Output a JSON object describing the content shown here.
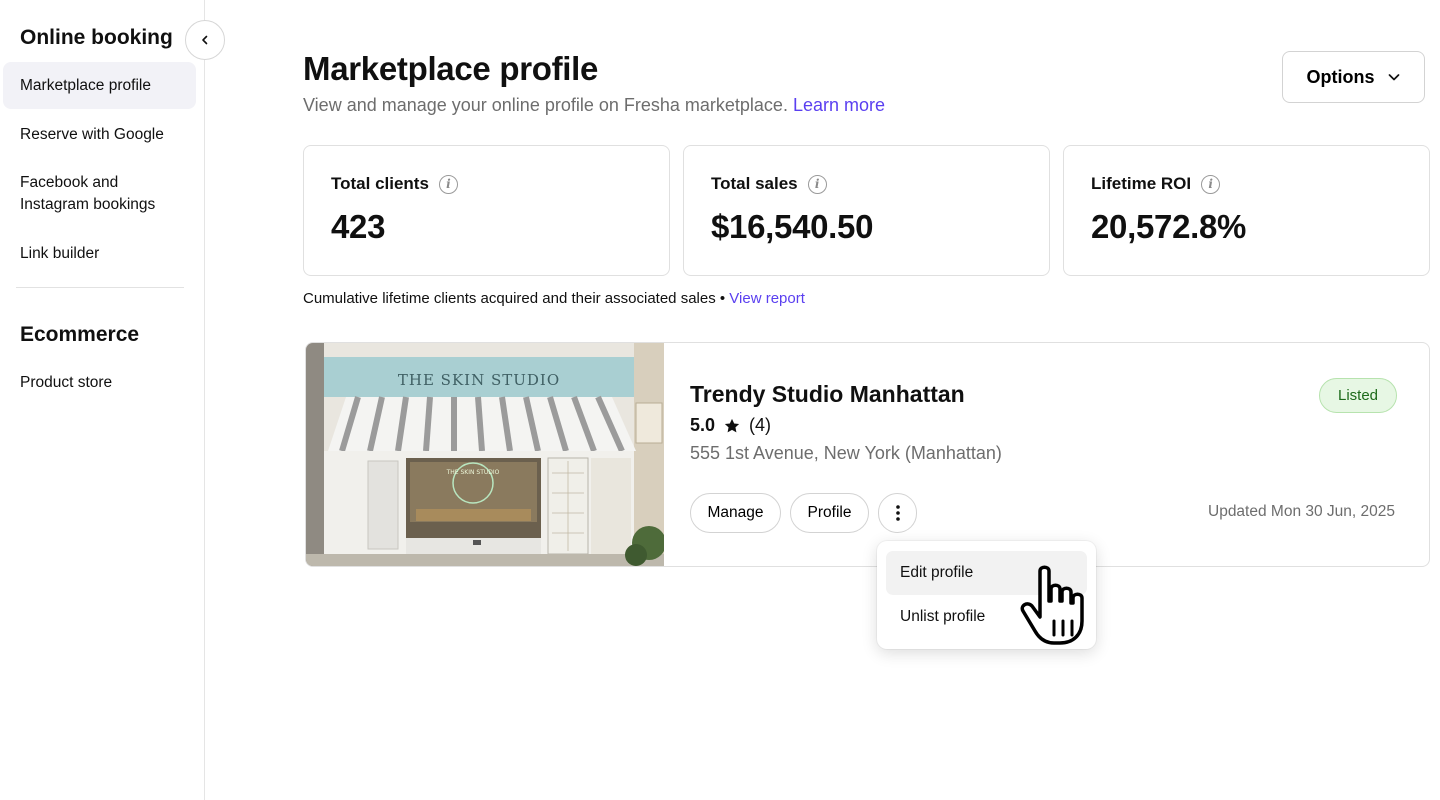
{
  "sidebar": {
    "online_booking_heading": "Online booking",
    "items": [
      {
        "label": "Marketplace profile",
        "active": true
      },
      {
        "label": "Reserve with Google",
        "active": false
      },
      {
        "label": "Facebook and Instagram bookings",
        "active": false
      },
      {
        "label": "Link builder",
        "active": false
      }
    ],
    "ecommerce_heading": "Ecommerce",
    "ecommerce_items": [
      {
        "label": "Product store"
      }
    ],
    "collapse_icon": "chevron-left-icon"
  },
  "header": {
    "title": "Marketplace profile",
    "subtitle": "View and manage your online profile on Fresha marketplace.",
    "learn_more": "Learn more",
    "options_label": "Options",
    "options_icon": "chevron-down-icon"
  },
  "stats": [
    {
      "label": "Total clients",
      "value": "423"
    },
    {
      "label": "Total sales",
      "value": "$16,540.50"
    },
    {
      "label": "Lifetime ROI",
      "value": "20,572.8%"
    }
  ],
  "caption": {
    "text": "Cumulative lifetime clients acquired and their associated sales •",
    "link": "View report"
  },
  "listing": {
    "name": "Trendy Studio Manhattan",
    "rating": "5.0",
    "review_count": "(4)",
    "address": "555 1st Avenue, New York (Manhattan)",
    "status": "Listed",
    "manage_label": "Manage",
    "profile_label": "Profile",
    "updated": "Updated Mon 30 Jun, 2025",
    "storefront_sign": "THE SKIN STUDIO",
    "window_sign": "THE SKIN STUDIO"
  },
  "dropdown": {
    "items": [
      {
        "label": "Edit profile",
        "hovered": true
      },
      {
        "label": "Unlist profile",
        "hovered": false
      }
    ]
  },
  "colors": {
    "accent_link": "#5a3ff0",
    "active_nav_bg": "#f2f2f7",
    "listed_badge_bg": "#e7f7e4",
    "listed_badge_text": "#1d6a1a"
  }
}
